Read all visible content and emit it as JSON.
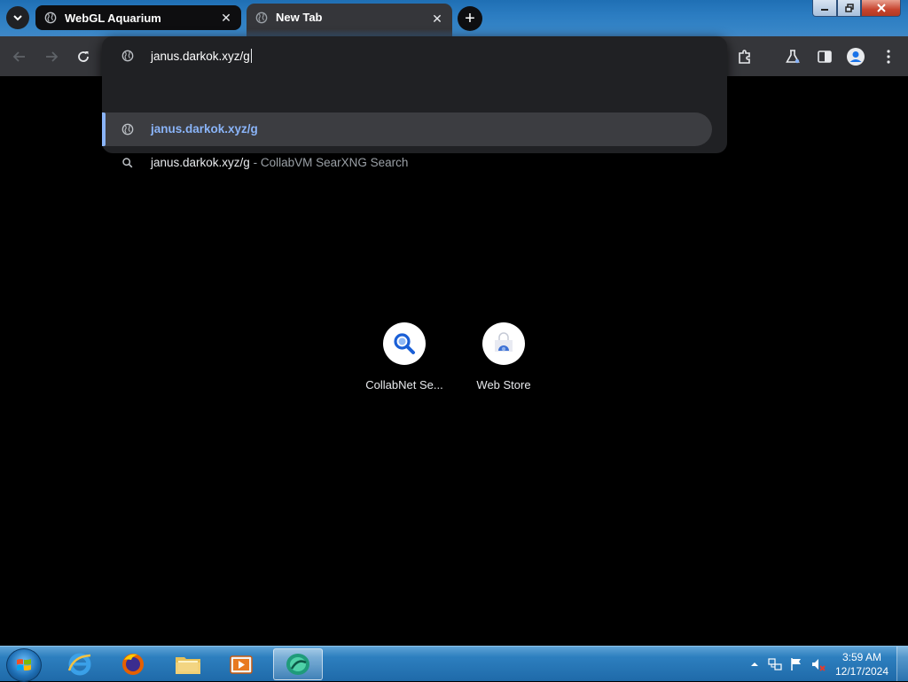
{
  "browser": {
    "tabs": [
      {
        "title": "WebGL Aquarium",
        "active": false
      },
      {
        "title": "New Tab",
        "active": true
      }
    ],
    "new_tab_symbol": "+",
    "close_symbol": "✕",
    "omnibox": {
      "value": "janus.darkok.xyz/g",
      "suggestions": [
        {
          "icon": "globe-icon",
          "text": "janus.darkok.xyz/g",
          "selected": true
        },
        {
          "icon": "search-icon",
          "text": "janus.darkok.xyz/g",
          "separator": "-",
          "description": "CollabVM SearXNG Search",
          "selected": false
        }
      ]
    },
    "toolbar_icons": [
      "back-icon",
      "forward-icon",
      "reload-icon",
      "extensions-icon",
      "labs-icon",
      "side-panel-icon",
      "profile-icon",
      "menu-icon"
    ]
  },
  "new_tab_page": {
    "shortcuts": [
      {
        "label": "CollabNet Se...",
        "icon": "magnifier-icon"
      },
      {
        "label": "Web Store",
        "icon": "web-store-icon"
      }
    ]
  },
  "taskbar": {
    "items": [
      "start-orb",
      "internet-explorer-icon",
      "firefox-icon",
      "file-explorer-icon",
      "media-player-icon",
      "chrome-app-icon"
    ],
    "clock": {
      "time": "3:59 AM",
      "date": "12/17/2024"
    }
  },
  "colors": {
    "accent": "#8ab4f8",
    "toolbar": "#35363a",
    "omnibox": "#202124",
    "page_bg": "#000000"
  }
}
